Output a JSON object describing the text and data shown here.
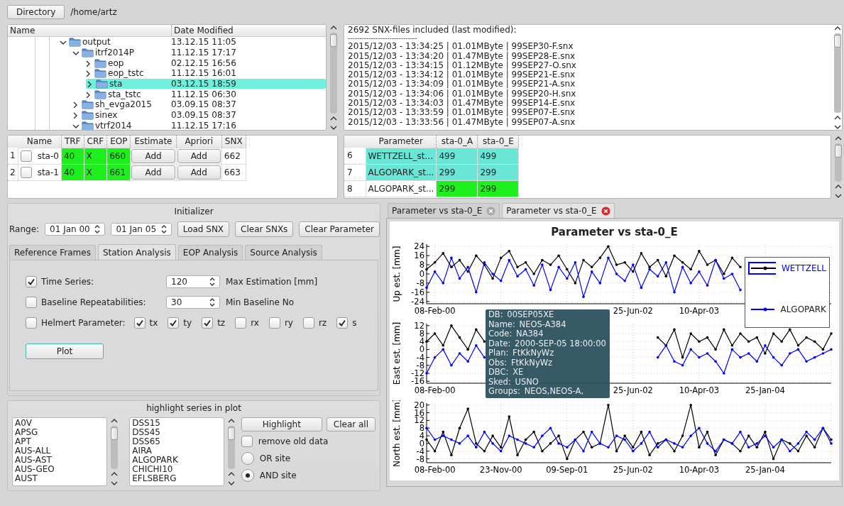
{
  "toolbar": {
    "button": "Directory",
    "path": "/home/artz"
  },
  "file_tree": {
    "columns": [
      "Name",
      "Date Modified"
    ],
    "items": [
      {
        "name": "output",
        "date": "13.12.15 11:05",
        "expanded": true,
        "selected": false,
        "children": [
          {
            "name": "itrf2014P",
            "date": "11.12.15 17:17",
            "expanded": true,
            "selected": false,
            "children": [
              {
                "name": "eop",
                "date": "02.12.15 16:56",
                "expanded": false,
                "selected": false
              },
              {
                "name": "eop_tstc",
                "date": "11.12.15 16:01",
                "expanded": false,
                "selected": false
              },
              {
                "name": "sta",
                "date": "03.12.15 18:59",
                "expanded": false,
                "selected": true
              },
              {
                "name": "sta_tstc",
                "date": "11.12.15 06:30",
                "expanded": false,
                "selected": false
              }
            ]
          },
          {
            "name": "sh_evga2015",
            "date": "03.09.15 08:37",
            "expanded": false,
            "selected": false
          },
          {
            "name": "sinex",
            "date": "03.09.15 08:37",
            "expanded": false,
            "selected": false
          },
          {
            "name": "vtrf2014",
            "date": "11.12.15 17:16",
            "expanded": true,
            "selected": false
          }
        ]
      }
    ]
  },
  "snx_log": {
    "header": "2692 SNX-files included (last modified):",
    "separator": "------------------------------",
    "lines": [
      "2015/12/03 - 13:34:25 | 01.01MByte | 99SEP30-F.snx",
      "2015/12/03 - 13:34:20 | 01.47MByte | 99SEP28-E.snx",
      "2015/12/03 - 13:34:15 | 01.12MByte | 99SEP27-O.snx",
      "2015/12/03 - 13:34:12 | 01.01MByte | 99SEP21-E.snx",
      "2015/12/03 - 13:34:09 | 01.01MByte | 99SEP21-A.snx",
      "2015/12/03 - 13:34:06 | 01.01MByte | 99SEP20-H.snx",
      "2015/12/03 - 13:34:03 | 01.47MByte | 99SEP14-E.snx",
      "2015/12/03 - 13:33:59 | 01.01MByte | 99SEP07-E.snx",
      "2015/12/03 - 13:33:56 | 01.47MByte | 99SEP07-A.snx"
    ]
  },
  "station_table": {
    "columns": [
      "Name",
      "TRF",
      "CRF",
      "EOP",
      "Estimate",
      "Apriori",
      "SNX"
    ],
    "rows": [
      {
        "number": "1",
        "cells": [
          {
            "kind": "checkbox",
            "text": "sta-0",
            "checked": false
          },
          {
            "kind": "text",
            "text": "40",
            "color": "#1ef01e"
          },
          {
            "kind": "text",
            "text": "X",
            "color": "#1ef01e"
          },
          {
            "kind": "text",
            "text": "660",
            "color": "#1ef01e"
          },
          {
            "kind": "button",
            "text": "Add"
          },
          {
            "kind": "button",
            "text": "Add"
          },
          {
            "kind": "text",
            "text": "662"
          }
        ]
      },
      {
        "number": "2",
        "cells": [
          {
            "kind": "checkbox",
            "text": "sta-1",
            "checked": false
          },
          {
            "kind": "text",
            "text": "40",
            "color": "#1ef01e"
          },
          {
            "kind": "text",
            "text": "X",
            "color": "#1ef01e"
          },
          {
            "kind": "text",
            "text": "661",
            "color": "#1ef01e"
          },
          {
            "kind": "button",
            "text": "Add"
          },
          {
            "kind": "button",
            "text": "Add"
          },
          {
            "kind": "text",
            "text": "663"
          }
        ]
      }
    ]
  },
  "param_table": {
    "columns": [
      "Parameter",
      "sta-0_A",
      "sta-0_E"
    ],
    "rows": [
      {
        "number": "6",
        "selected": true,
        "cells": [
          {
            "text": "WETTZELL_st..."
          },
          {
            "text": "499"
          },
          {
            "text": "499"
          }
        ]
      },
      {
        "number": "7",
        "selected": true,
        "cells": [
          {
            "text": "ALGOPARK_st..."
          },
          {
            "text": "299"
          },
          {
            "text": "299"
          }
        ]
      },
      {
        "number": "8",
        "selected": false,
        "cells": [
          {
            "text": "ALGOPARK_st..."
          },
          {
            "text": "299",
            "color": "#1ef01e"
          },
          {
            "text": "299",
            "color": "#1ef01e"
          }
        ]
      }
    ]
  },
  "initializer": {
    "title": "Initializer",
    "range_label": "Range:",
    "date_from": "01 Jan 00",
    "date_to": "01 Jan 05",
    "buttons": [
      "Load SNX",
      "Clear SNXs",
      "Clear Parameter"
    ]
  },
  "analysis_tabs": [
    {
      "label": "Reference Frames",
      "selected": false
    },
    {
      "label": "Station Analysis",
      "selected": true
    },
    {
      "label": "EOP Analysis",
      "selected": false
    },
    {
      "label": "Source Analysis",
      "selected": false
    }
  ],
  "station_analysis": {
    "options": [
      {
        "kind": "spin",
        "label": "Time Series:",
        "checked": true,
        "value": "120",
        "unit": "Max Estimation [mm]"
      },
      {
        "kind": "spin",
        "label": "Baseline Repeatabilities:",
        "checked": false,
        "value": "30",
        "unit": "Min Baseline No"
      },
      {
        "kind": "checks",
        "label": "Helmert Parameter:",
        "checked": false,
        "params": [
          {
            "label": "tx",
            "checked": true
          },
          {
            "label": "ty",
            "checked": true
          },
          {
            "label": "tz",
            "checked": true
          },
          {
            "label": "rx",
            "checked": false
          },
          {
            "label": "ry",
            "checked": false
          },
          {
            "label": "rz",
            "checked": false
          },
          {
            "label": "s",
            "checked": true
          }
        ]
      }
    ],
    "plot_button": "Plot"
  },
  "highlight": {
    "title": "highlight series in plot",
    "list_1": [
      "A0V",
      "APSG",
      "APT",
      "AUS-ALL",
      "AUS-AST",
      "AUS-GEO",
      "AUST"
    ],
    "list_2": [
      "DSS15",
      "DSS45",
      "DSS65",
      "AIRA",
      "ALGOPARK",
      "CHICHI10",
      "EFLSBERG"
    ],
    "buttons": [
      "Highlight",
      "Clear all"
    ],
    "remove_old_data": {
      "label": "remove old data",
      "checked": false
    },
    "modes": [
      {
        "label": "OR site",
        "selected": false
      },
      {
        "label": "AND site",
        "selected": true
      }
    ]
  },
  "plot_tabs": [
    {
      "label": "Parameter vs sta-0_E",
      "selected": false
    },
    {
      "label": "Parameter vs sta-0_E",
      "selected": true
    }
  ],
  "plot": {
    "title": "Parameter vs sta-0_E",
    "panels": [
      {
        "chart_data": {
          "type": "line",
          "ylabel": "Up est. [mm]",
          "grid": true,
          "categories": [
            null,
            "08-Feb-00",
            null,
            null,
            null,
            null,
            null,
            null,
            null,
            null,
            null,
            null,
            null,
            null,
            null,
            null,
            null,
            null,
            null,
            null,
            null,
            null,
            null,
            null,
            null,
            "25-Jun-02",
            null,
            null,
            null,
            null,
            null,
            null,
            null,
            "10-Apr-03",
            null,
            null,
            null,
            null,
            null,
            null,
            null,
            null,
            null,
            null,
            null,
            null,
            null,
            null,
            null,
            null
          ],
          "ylim": [
            -26,
            26
          ],
          "yticks": [
            24,
            16,
            8,
            0,
            -8,
            -16,
            -24
          ],
          "series": [
            {
              "color": "#000000",
              "values": [
                4,
                10,
                18,
                6,
                12,
                2,
                16,
                8,
                -4,
                14,
                20,
                6,
                10,
                0,
                12,
                8,
                16,
                4,
                -8,
                12,
                6,
                14,
                24,
                8,
                10,
                2,
                18,
                6,
                12,
                -2,
                16,
                10,
                4,
                20,
                8,
                12,
                0,
                14,
                6,
                null,
                null,
                null,
                null,
                null,
                null,
                null,
                null,
                null,
                null,
                null
              ]
            },
            {
              "color": "#0000ff",
              "values": [
                -12,
                2,
                -8,
                14,
                -4,
                6,
                -16,
                10,
                0,
                -6,
                12,
                -2,
                4,
                -10,
                8,
                -14,
                6,
                -4,
                10,
                -20,
                2,
                -8,
                14,
                0,
                -6,
                8,
                -12,
                4,
                -2,
                10,
                -16,
                6,
                -8,
                2,
                -10,
                12,
                -4,
                0,
                -14,
                null,
                null,
                null,
                null,
                null,
                null,
                null,
                null,
                null,
                null,
                null
              ]
            }
          ]
        }
      },
      {
        "chart_data": {
          "type": "line",
          "ylabel": "East est. [mm]",
          "grid": true,
          "categories": [
            null,
            "08-Feb-00",
            null,
            null,
            null,
            null,
            null,
            null,
            null,
            null,
            null,
            null,
            null,
            null,
            null,
            null,
            null,
            null,
            null,
            null,
            null,
            null,
            null,
            null,
            null,
            "25-Jun-02",
            null,
            null,
            null,
            null,
            null,
            null,
            null,
            "10-Apr-03",
            null,
            null,
            null,
            null,
            null,
            null,
            null,
            "25-Jan-04",
            null,
            null,
            null,
            null,
            null,
            null,
            null,
            null
          ],
          "ylim": [
            -17,
            13
          ],
          "yticks": [
            12,
            8,
            4,
            0,
            -4,
            -8,
            -12,
            -16
          ],
          "series": [
            {
              "color": "#000000",
              "values": [
                4,
                8,
                2,
                12,
                6,
                0,
                10,
                4,
                null,
                null,
                null,
                null,
                null,
                null,
                null,
                null,
                null,
                null,
                null,
                null,
                null,
                null,
                null,
                null,
                null,
                null,
                null,
                null,
                6,
                2,
                10,
                -4,
                8,
                4,
                6,
                0,
                10,
                2,
                8,
                4,
                6,
                -2,
                8,
                4,
                10,
                2,
                6,
                4,
                0,
                8
              ]
            },
            {
              "color": "#0000ff",
              "values": [
                -12,
                -4,
                0,
                -8,
                -2,
                -6,
                2,
                -4,
                null,
                null,
                null,
                null,
                null,
                null,
                null,
                null,
                null,
                null,
                null,
                null,
                null,
                null,
                null,
                null,
                null,
                null,
                null,
                null,
                -4,
                2,
                -6,
                -8,
                0,
                -4,
                -2,
                -6,
                -12,
                0,
                -4,
                -2,
                -6,
                2,
                -4,
                -8,
                -2,
                0,
                -6,
                -4,
                -2,
                0
              ]
            }
          ]
        }
      },
      {
        "chart_data": {
          "type": "line",
          "ylabel": "North est. [mm]",
          "grid": true,
          "categories": [
            null,
            "08-Feb-00",
            null,
            null,
            null,
            null,
            null,
            null,
            null,
            "23-Nov-00",
            null,
            null,
            null,
            null,
            null,
            null,
            null,
            "09-Sep-01",
            null,
            null,
            null,
            null,
            null,
            null,
            null,
            "25-Jun-02",
            null,
            null,
            null,
            null,
            null,
            null,
            null,
            "10-Apr-03",
            null,
            null,
            null,
            null,
            null,
            null,
            null,
            "25-Jan-04",
            null,
            null,
            null,
            null,
            null,
            null,
            null,
            null
          ],
          "ylim": [
            -10,
            21
          ],
          "yticks": [
            20,
            16,
            12,
            8,
            4,
            0,
            -4,
            -8
          ],
          "series": [
            {
              "color": "#000000",
              "values": [
                2,
                -4,
                6,
                -6,
                8,
                18,
                0,
                -4,
                4,
                -2,
                14,
                -6,
                2,
                6,
                -4,
                0,
                4,
                -8,
                2,
                6,
                -2,
                0,
                20,
                -4,
                4,
                -2,
                6,
                -6,
                0,
                2,
                -4,
                4,
                20,
                -2,
                6,
                -6,
                2,
                0,
                -4,
                4,
                -2,
                6,
                -8,
                2,
                0,
                -4,
                4,
                -2,
                8,
                2
              ]
            },
            {
              "color": "#0000ff",
              "values": [
                8,
                2,
                4,
                2,
                0,
                4,
                -2,
                6,
                0,
                -4,
                4,
                2,
                0,
                -2,
                4,
                8,
                0,
                -2,
                2,
                -4,
                6,
                0,
                -2,
                4,
                2,
                -4,
                0,
                6,
                -2,
                2,
                0,
                -2,
                4,
                8,
                0,
                -4,
                2,
                0,
                6,
                -2,
                0,
                4,
                -2,
                2,
                -4,
                0,
                6,
                2,
                8,
                0
              ]
            }
          ]
        }
      }
    ],
    "legend": [
      {
        "name": "WETTZELL",
        "color": "#000000",
        "selected": true
      },
      {
        "name": "ALGOPARK",
        "color": "#0000ff",
        "selected": false
      }
    ],
    "tooltip": [
      {
        "key": "DB:",
        "value": "00SEP05XE"
      },
      {
        "key": "Name:",
        "value": "NEOS-A384"
      },
      {
        "key": "Code:",
        "value": "NA384"
      },
      {
        "key": "Date:",
        "value": "2000-SEP-05 18:00:00"
      },
      {
        "key": "Plan:",
        "value": "FtKkNyWz"
      },
      {
        "key": "Obs:",
        "value": "FtKkNyWz"
      },
      {
        "key": "DBC:",
        "value": "XE"
      },
      {
        "key": "Sked:",
        "value": "USNO"
      },
      {
        "key": "Groups:",
        "value": "NEOS,NEOS-A,"
      }
    ]
  }
}
